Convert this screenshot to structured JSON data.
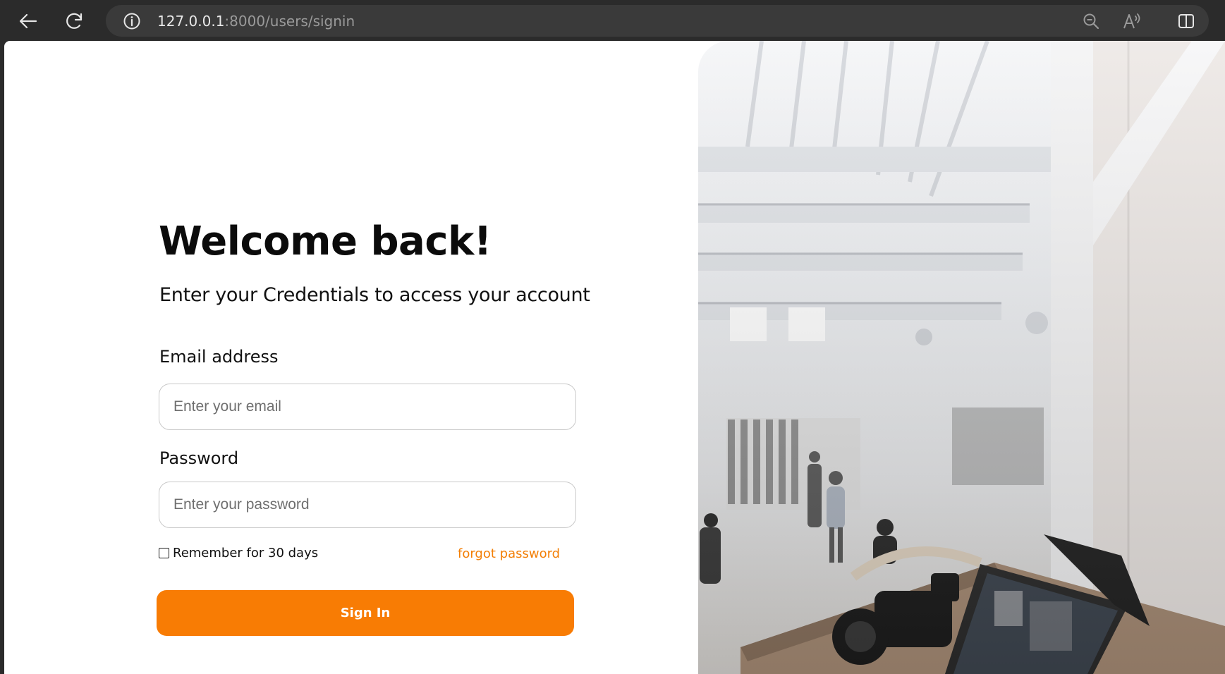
{
  "browser": {
    "url_host": "127.0.0.1",
    "url_rest": ":8000/users/signin",
    "icons": {
      "back": "back-arrow-icon",
      "reload": "reload-icon",
      "info": "info-icon",
      "zoom": "zoom-out-icon",
      "read_aloud": "read-aloud-icon",
      "split": "split-screen-icon"
    }
  },
  "signin": {
    "title": "Welcome back!",
    "subtitle": "Enter your Credentials to access your account",
    "email": {
      "label": "Email address",
      "placeholder": "Enter your email",
      "value": ""
    },
    "password": {
      "label": "Password",
      "placeholder": "Enter your password",
      "value": ""
    },
    "remember_label": "Remember for 30 days",
    "remember_checked": false,
    "forgot_label": "forgot password",
    "submit_label": "Sign In"
  },
  "colors": {
    "accent": "#f87c04",
    "link": "#f37f06",
    "text": "#111111"
  }
}
